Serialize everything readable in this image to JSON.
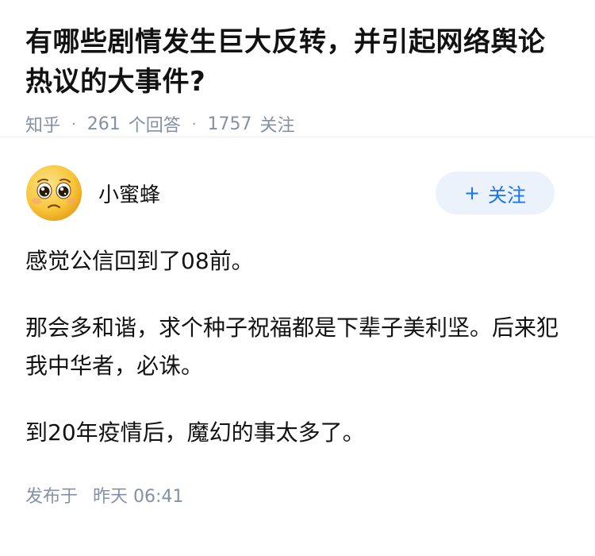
{
  "question": {
    "title": "有哪些剧情发生巨大反转，并引起网络舆论热议的大事件?",
    "source": "知乎",
    "answer_count": "261",
    "answer_label": "个回答",
    "follow_count": "1757",
    "follow_label": "关注"
  },
  "answer": {
    "author": "小蜜蜂",
    "follow_button_label": "关注",
    "paragraphs": [
      "感觉公信回到了08前。",
      "那会多和谐，求个种子祝福都是下辈子美利坚。后来犯我中华者，必诛。",
      "到20年疫情后，魔幻的事太多了。"
    ],
    "publish_label": "发布于",
    "publish_time": "昨天 06:41"
  },
  "colors": {
    "muted": "#8590a6",
    "accent": "#1772f6",
    "button_bg": "#ebf2fc"
  },
  "icons": {
    "avatar": "pleading-face-emoji",
    "follow_plus": "plus-icon"
  }
}
